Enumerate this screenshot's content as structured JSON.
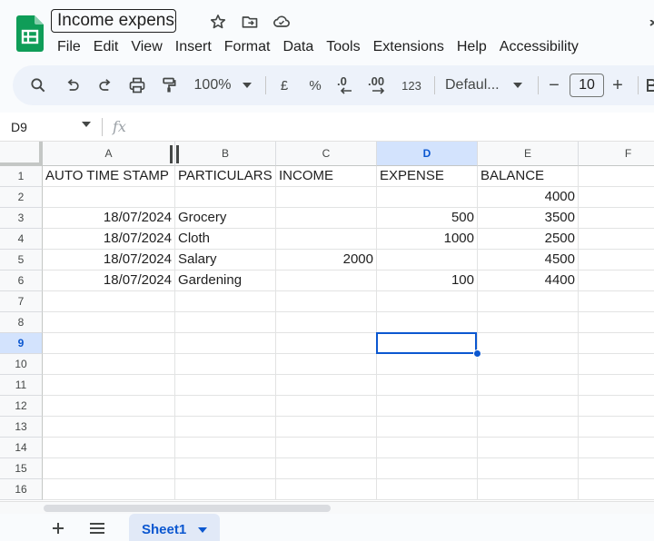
{
  "document": {
    "title": "Income expense"
  },
  "menu": [
    "File",
    "Edit",
    "View",
    "Insert",
    "Format",
    "Data",
    "Tools",
    "Extensions",
    "Help",
    "Accessibility"
  ],
  "toolbar": {
    "zoom": "100%",
    "currency": "£",
    "percent": "%",
    "decrease_decimal": ".0",
    "increase_decimal": ".00",
    "number_format": "123",
    "font": "Defaul...",
    "font_size": "10",
    "decrease_size": "−",
    "increase_size": "+"
  },
  "formula_bar": {
    "cell_ref": "D9",
    "fx": "fx",
    "value": ""
  },
  "grid": {
    "columns": [
      "A",
      "B",
      "C",
      "D",
      "E",
      "F"
    ],
    "active_column": "D",
    "active_row": "9",
    "rows": [
      {
        "n": "1",
        "cells": [
          "AUTO TIME STAMP",
          "PARTICULARS",
          "INCOME",
          "EXPENSE",
          "BALANCE",
          ""
        ]
      },
      {
        "n": "2",
        "cells": [
          "",
          "",
          "",
          "",
          "4000",
          ""
        ]
      },
      {
        "n": "3",
        "cells": [
          "18/07/2024",
          "Grocery",
          "",
          "500",
          "3500",
          ""
        ]
      },
      {
        "n": "4",
        "cells": [
          "18/07/2024",
          "Cloth",
          "",
          "1000",
          "2500",
          ""
        ]
      },
      {
        "n": "5",
        "cells": [
          "18/07/2024",
          "Salary",
          "2000",
          "",
          "4500",
          ""
        ]
      },
      {
        "n": "6",
        "cells": [
          "18/07/2024",
          "Gardening",
          "",
          "100",
          "4400",
          ""
        ]
      },
      {
        "n": "7",
        "cells": [
          "",
          "",
          "",
          "",
          "",
          ""
        ]
      },
      {
        "n": "8",
        "cells": [
          "",
          "",
          "",
          "",
          "",
          ""
        ]
      },
      {
        "n": "9",
        "cells": [
          "",
          "",
          "",
          "",
          "",
          ""
        ]
      },
      {
        "n": "10",
        "cells": [
          "",
          "",
          "",
          "",
          "",
          ""
        ]
      },
      {
        "n": "11",
        "cells": [
          "",
          "",
          "",
          "",
          "",
          ""
        ]
      },
      {
        "n": "12",
        "cells": [
          "",
          "",
          "",
          "",
          "",
          ""
        ]
      },
      {
        "n": "13",
        "cells": [
          "",
          "",
          "",
          "",
          "",
          ""
        ]
      },
      {
        "n": "14",
        "cells": [
          "",
          "",
          "",
          "",
          "",
          ""
        ]
      },
      {
        "n": "15",
        "cells": [
          "",
          "",
          "",
          "",
          "",
          ""
        ]
      },
      {
        "n": "16",
        "cells": [
          "",
          "",
          "",
          "",
          "",
          ""
        ]
      }
    ]
  },
  "sheets": [
    {
      "name": "Sheet1",
      "active": true
    }
  ],
  "colors": {
    "accent": "#0b57d0",
    "selected_header": "#d3e3fd",
    "logo_green": "#0f9d58"
  }
}
